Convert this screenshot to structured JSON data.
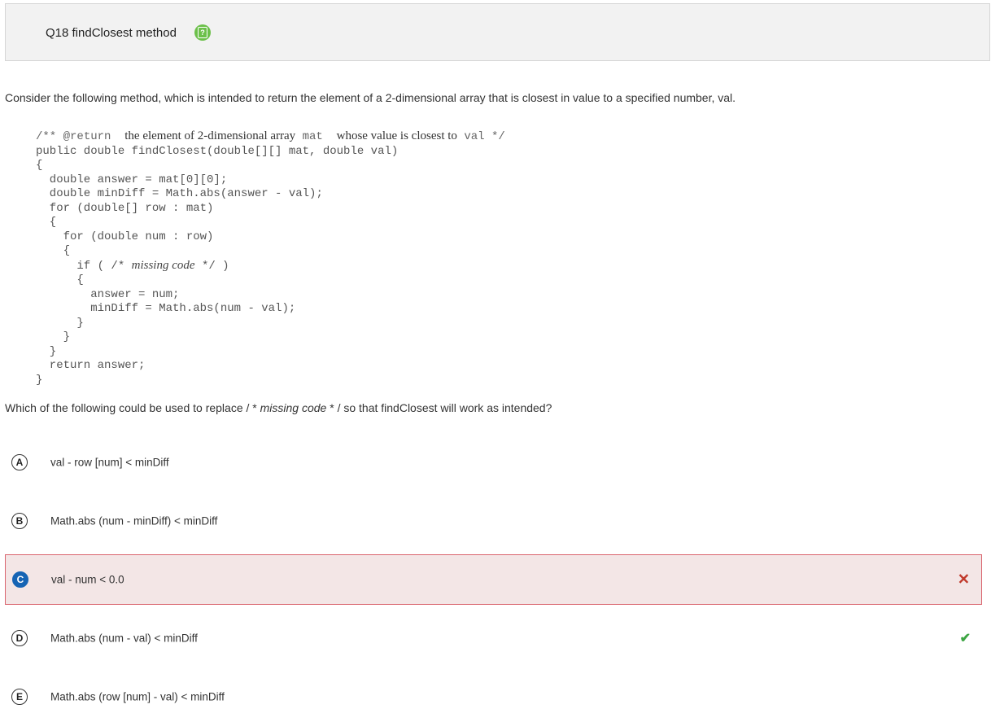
{
  "header": {
    "title": "Q18 findClosest method",
    "help_icon": "question-mark-icon",
    "help_color": "#6cc04a"
  },
  "prompt": "Consider the following method, which is intended to return the element of a 2-dimensional array that is closest in value to a specified number, val.",
  "code": {
    "doc_open": "/**",
    "doc_tag": "@return",
    "doc_text1": "the element of 2-dimensional array",
    "doc_mat": "mat",
    "doc_text2": "whose value is closest to",
    "doc_val": "val",
    "doc_close": "*/",
    "lines": [
      "public double findClosest(double[][] mat, double val)",
      "{",
      "  double answer = mat[0][0];",
      "  double minDiff = Math.abs(answer - val);",
      "  for (double[] row : mat)",
      "  {",
      "    for (double num : row)",
      "    {"
    ],
    "if_prefix": "      if ( /*",
    "missing_code": "missing code",
    "if_suffix": "*/ )",
    "lines_after": [
      "      {",
      "        answer = num;",
      "        minDiff = Math.abs(num - val);",
      "      }",
      "    }",
      "  }",
      "  return answer;",
      "}"
    ]
  },
  "question": {
    "before": "Which of the following could be used to replace / *",
    "italic": "missing code",
    "after": "* / so that findClosest will work as intended?"
  },
  "choices": [
    {
      "letter": "A",
      "text": "val - row [num] < minDiff",
      "state": "none"
    },
    {
      "letter": "B",
      "text": "Math.abs (num - minDiff) < minDiff",
      "state": "none"
    },
    {
      "letter": "C",
      "text": "val - num < 0.0",
      "state": "selected-incorrect"
    },
    {
      "letter": "D",
      "text": "Math.abs (num - val) < minDiff",
      "state": "correct"
    },
    {
      "letter": "E",
      "text": "Math.abs (row [num] - val) < minDiff",
      "state": "none"
    }
  ],
  "marks": {
    "wrong": "✕",
    "right": "✔"
  },
  "colors": {
    "selected_bg": "#f3e6e6",
    "selected_border": "#d9646e",
    "selected_badge": "#1664b4",
    "wrong": "#c0392b",
    "right": "#3da543"
  }
}
